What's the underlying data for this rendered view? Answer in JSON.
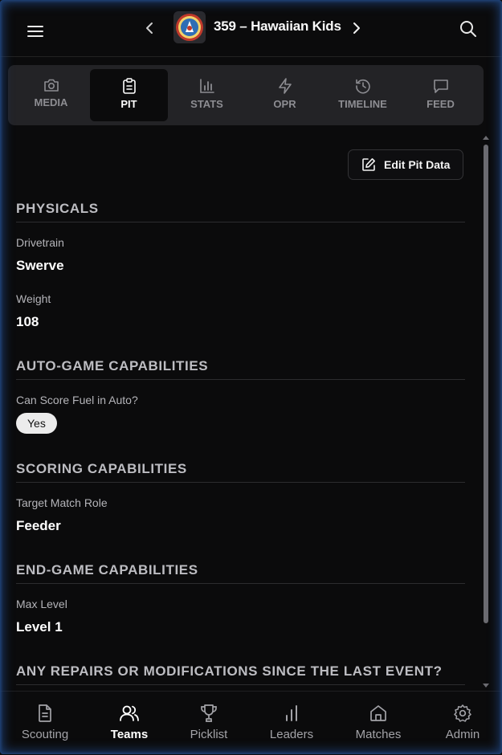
{
  "header": {
    "team_title": "359 – Hawaiian Kids",
    "menu_icon": "hamburger-icon",
    "prev_icon": "chevron-left-icon",
    "next_icon": "chevron-right-icon",
    "search_icon": "search-icon"
  },
  "tabs": [
    {
      "label": "MEDIA",
      "icon": "camera-icon"
    },
    {
      "label": "PIT",
      "icon": "clipboard-icon",
      "active": true
    },
    {
      "label": "STATS",
      "icon": "bar-chart-icon"
    },
    {
      "label": "OPR",
      "icon": "lightning-icon"
    },
    {
      "label": "TIMELINE",
      "icon": "history-icon"
    },
    {
      "label": "FEED",
      "icon": "message-icon"
    }
  ],
  "content": {
    "edit_button": "Edit Pit Data",
    "sections": {
      "physicals": {
        "title": "PHYSICALS",
        "drivetrain_label": "Drivetrain",
        "drivetrain_value": "Swerve",
        "weight_label": "Weight",
        "weight_value": "108"
      },
      "auto": {
        "title": "AUTO-GAME CAPABILITIES",
        "fuel_label": "Can Score Fuel in Auto?",
        "fuel_value": "Yes"
      },
      "scoring": {
        "title": "SCORING CAPABILITIES",
        "role_label": "Target Match Role",
        "role_value": "Feeder"
      },
      "endgame": {
        "title": "END-GAME CAPABILITIES",
        "level_label": "Max Level",
        "level_value": "Level 1"
      },
      "repairs": {
        "title": "ANY REPAIRS OR MODIFICATIONS SINCE THE LAST EVENT?"
      }
    }
  },
  "bottom_nav": [
    {
      "label": "Scouting",
      "icon": "document-icon"
    },
    {
      "label": "Teams",
      "icon": "users-icon",
      "active": true
    },
    {
      "label": "Picklist",
      "icon": "trophy-icon"
    },
    {
      "label": "Leaders",
      "icon": "bar-chart-icon"
    },
    {
      "label": "Matches",
      "icon": "home-icon"
    },
    {
      "label": "Admin",
      "icon": "gear-icon"
    }
  ]
}
